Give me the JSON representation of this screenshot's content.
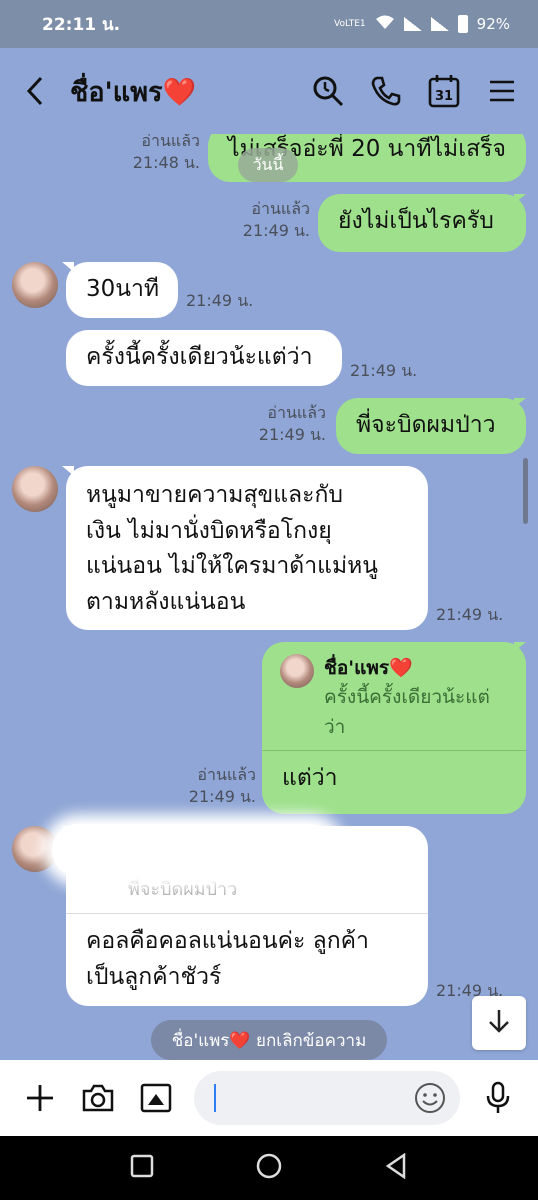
{
  "status_bar": {
    "time": "22:11 น.",
    "volte": "VoLTE1",
    "battery": "92%"
  },
  "header": {
    "contact_name": "ชื่อ'แพร",
    "heart": "❤️"
  },
  "messages": [
    {
      "text": "ไม่เสร็จอ่ะพี่ 20 นาทีไม่เสร็จ",
      "read": "อ่านแล้ว",
      "time": "21:48 น.",
      "overlay": "วันนี้"
    },
    {
      "text": "ยังไม่เป็นไรครับ",
      "read": "อ่านแล้ว",
      "time": "21:49 น."
    },
    {
      "text": "30นาที",
      "time": "21:49 น."
    },
    {
      "text": "ครั้งนี้ครั้งเดียวน้ะแต่ว่า",
      "time": "21:49 น."
    },
    {
      "text": "พี่จะบิดผมป่าว",
      "read": "อ่านแล้ว",
      "time": "21:49 น."
    },
    {
      "lines": [
        "หนูมาขายความสุขและกับ",
        "เงิน ไม่มานั่งบิดหรือโกงยุ",
        "แน่นอน ไม่ให้ใครมาด้าแม่หนู",
        "ตามหลังแน่นอน"
      ],
      "time": "21:49 น."
    },
    {
      "quote_name": "ชื่อ'แพร❤️",
      "quote_text": "ครั้งนี้ครั้งเดียวน้ะแต่ว่า",
      "text": "แต่ว่า",
      "read": "อ่านแล้ว",
      "time": "21:49 น."
    },
    {
      "hidden_quote": "พี่จะบิดผมป่าว",
      "lines": [
        "คอลคือคอลแน่นอนค่ะ  ลูกค้า",
        "เป็นลูกค้าชัวร์"
      ],
      "time": "21:49 น."
    }
  ],
  "system_message": "ชื่อ'แพร❤️ ยกเลิกข้อความ",
  "input": {
    "placeholder": ""
  },
  "icons": [
    "back-icon",
    "search-icon",
    "phone-icon",
    "calendar-icon",
    "menu-icon",
    "plus-icon",
    "camera-icon",
    "image-icon",
    "emoji-icon",
    "mic-icon",
    "arrow-down-icon",
    "square-icon",
    "circle-icon",
    "triangle-icon"
  ],
  "calendar_day": "31",
  "colors": {
    "background": "#8fa6d6",
    "outgoing": "#9ee08b",
    "incoming": "#ffffff",
    "heart": "#e53935"
  }
}
